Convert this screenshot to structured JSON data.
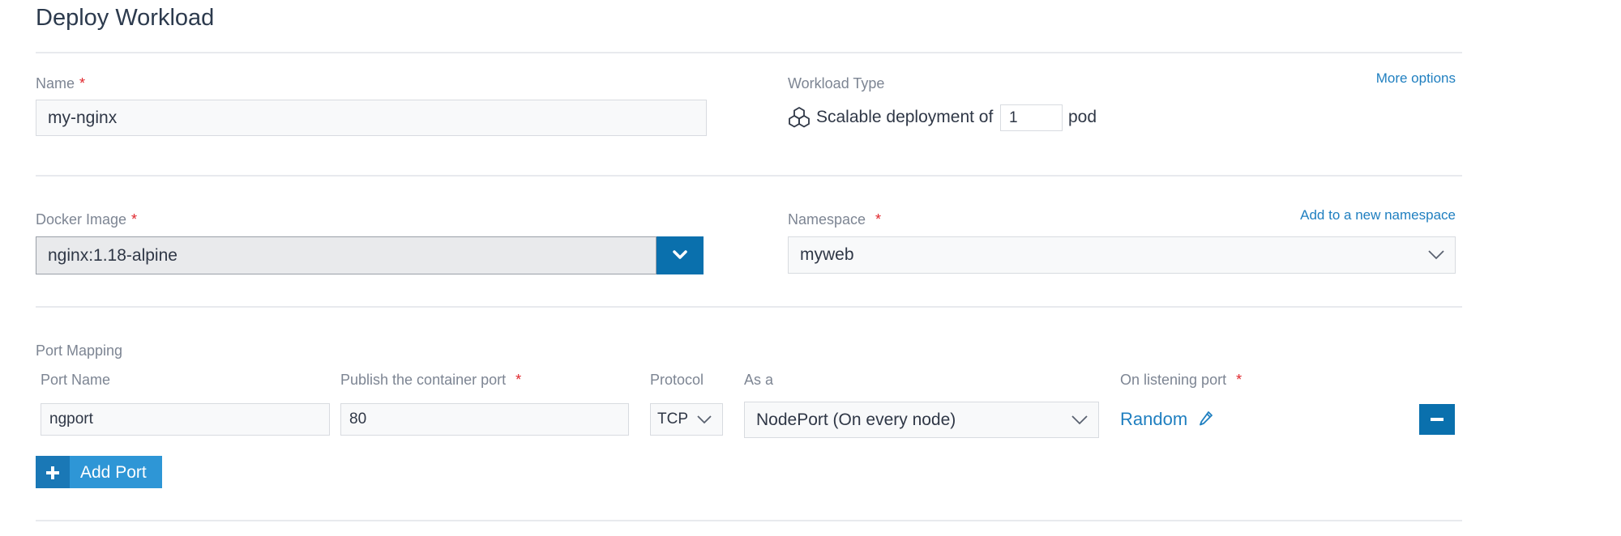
{
  "page": {
    "title": "Deploy Workload"
  },
  "name_field": {
    "label": "Name",
    "required": "*",
    "value": "my-nginx"
  },
  "workload_type": {
    "label": "Workload Type",
    "more_options": "More options",
    "prefix": "Scalable deployment of",
    "count": "1",
    "suffix": "pod"
  },
  "docker_image": {
    "label": "Docker Image",
    "required": "*",
    "value": "nginx:1.18-alpine"
  },
  "namespace": {
    "label": "Namespace",
    "required": "*",
    "add_link": "Add to a new namespace",
    "value": "myweb"
  },
  "port_mapping": {
    "label": "Port Mapping",
    "headers": {
      "port_name": "Port Name",
      "publish": "Publish the container port",
      "publish_required": "*",
      "protocol": "Protocol",
      "as_a": "As a",
      "listening": "On listening port",
      "listening_required": "*"
    },
    "row": {
      "port_name": "ngport",
      "publish": "80",
      "protocol": "TCP",
      "as_a": "NodePort (On every node)",
      "listening": "Random"
    },
    "add_port": "Add Port"
  },
  "colors": {
    "accent": "#0a70ad",
    "link": "#1f7fc0",
    "required": "#e0262c"
  },
  "icons": {
    "workload": "cubes-icon",
    "dropdown": "chevron-down-icon",
    "edit": "pencil-icon",
    "remove": "minus-icon",
    "add": "plus-icon"
  }
}
